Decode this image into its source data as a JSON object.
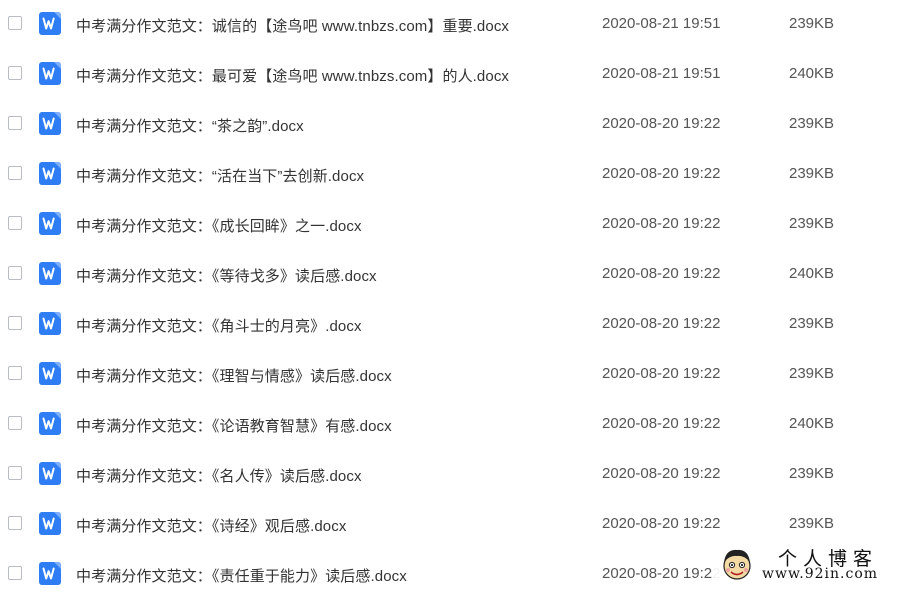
{
  "files": [
    {
      "name": "中考满分作文范文：诚信的【途鸟吧 www.tnbzs.com】重要.docx",
      "date": "2020-08-21 19:51",
      "size": "239KB"
    },
    {
      "name": "中考满分作文范文：最可爱【途鸟吧 www.tnbzs.com】的人.docx",
      "date": "2020-08-21 19:51",
      "size": "240KB"
    },
    {
      "name": "中考满分作文范文：“茶之韵”.docx",
      "date": "2020-08-20 19:22",
      "size": "239KB"
    },
    {
      "name": "中考满分作文范文：“活在当下”去创新.docx",
      "date": "2020-08-20 19:22",
      "size": "239KB"
    },
    {
      "name": "中考满分作文范文：《成长回眸》之一.docx",
      "date": "2020-08-20 19:22",
      "size": "239KB"
    },
    {
      "name": "中考满分作文范文：《等待戈多》读后感.docx",
      "date": "2020-08-20 19:22",
      "size": "240KB"
    },
    {
      "name": "中考满分作文范文：《角斗士的月亮》.docx",
      "date": "2020-08-20 19:22",
      "size": "239KB"
    },
    {
      "name": "中考满分作文范文：《理智与情感》读后感.docx",
      "date": "2020-08-20 19:22",
      "size": "239KB"
    },
    {
      "name": "中考满分作文范文：《论语教育智慧》有感.docx",
      "date": "2020-08-20 19:22",
      "size": "240KB"
    },
    {
      "name": "中考满分作文范文：《名人传》读后感.docx",
      "date": "2020-08-20 19:22",
      "size": "239KB"
    },
    {
      "name": "中考满分作文范文：《诗经》观后感.docx",
      "date": "2020-08-20 19:22",
      "size": "239KB"
    },
    {
      "name": "中考满分作文范文：《责任重于能力》读后感.docx",
      "date": "2020-08-20 19:22",
      "size": ""
    }
  ],
  "file_icon": "word-doc-icon",
  "colors": {
    "word_icon": "#2f7df5",
    "text": "#333333"
  },
  "watermark": {
    "title": "个人博客",
    "url": "www.92in.com"
  }
}
